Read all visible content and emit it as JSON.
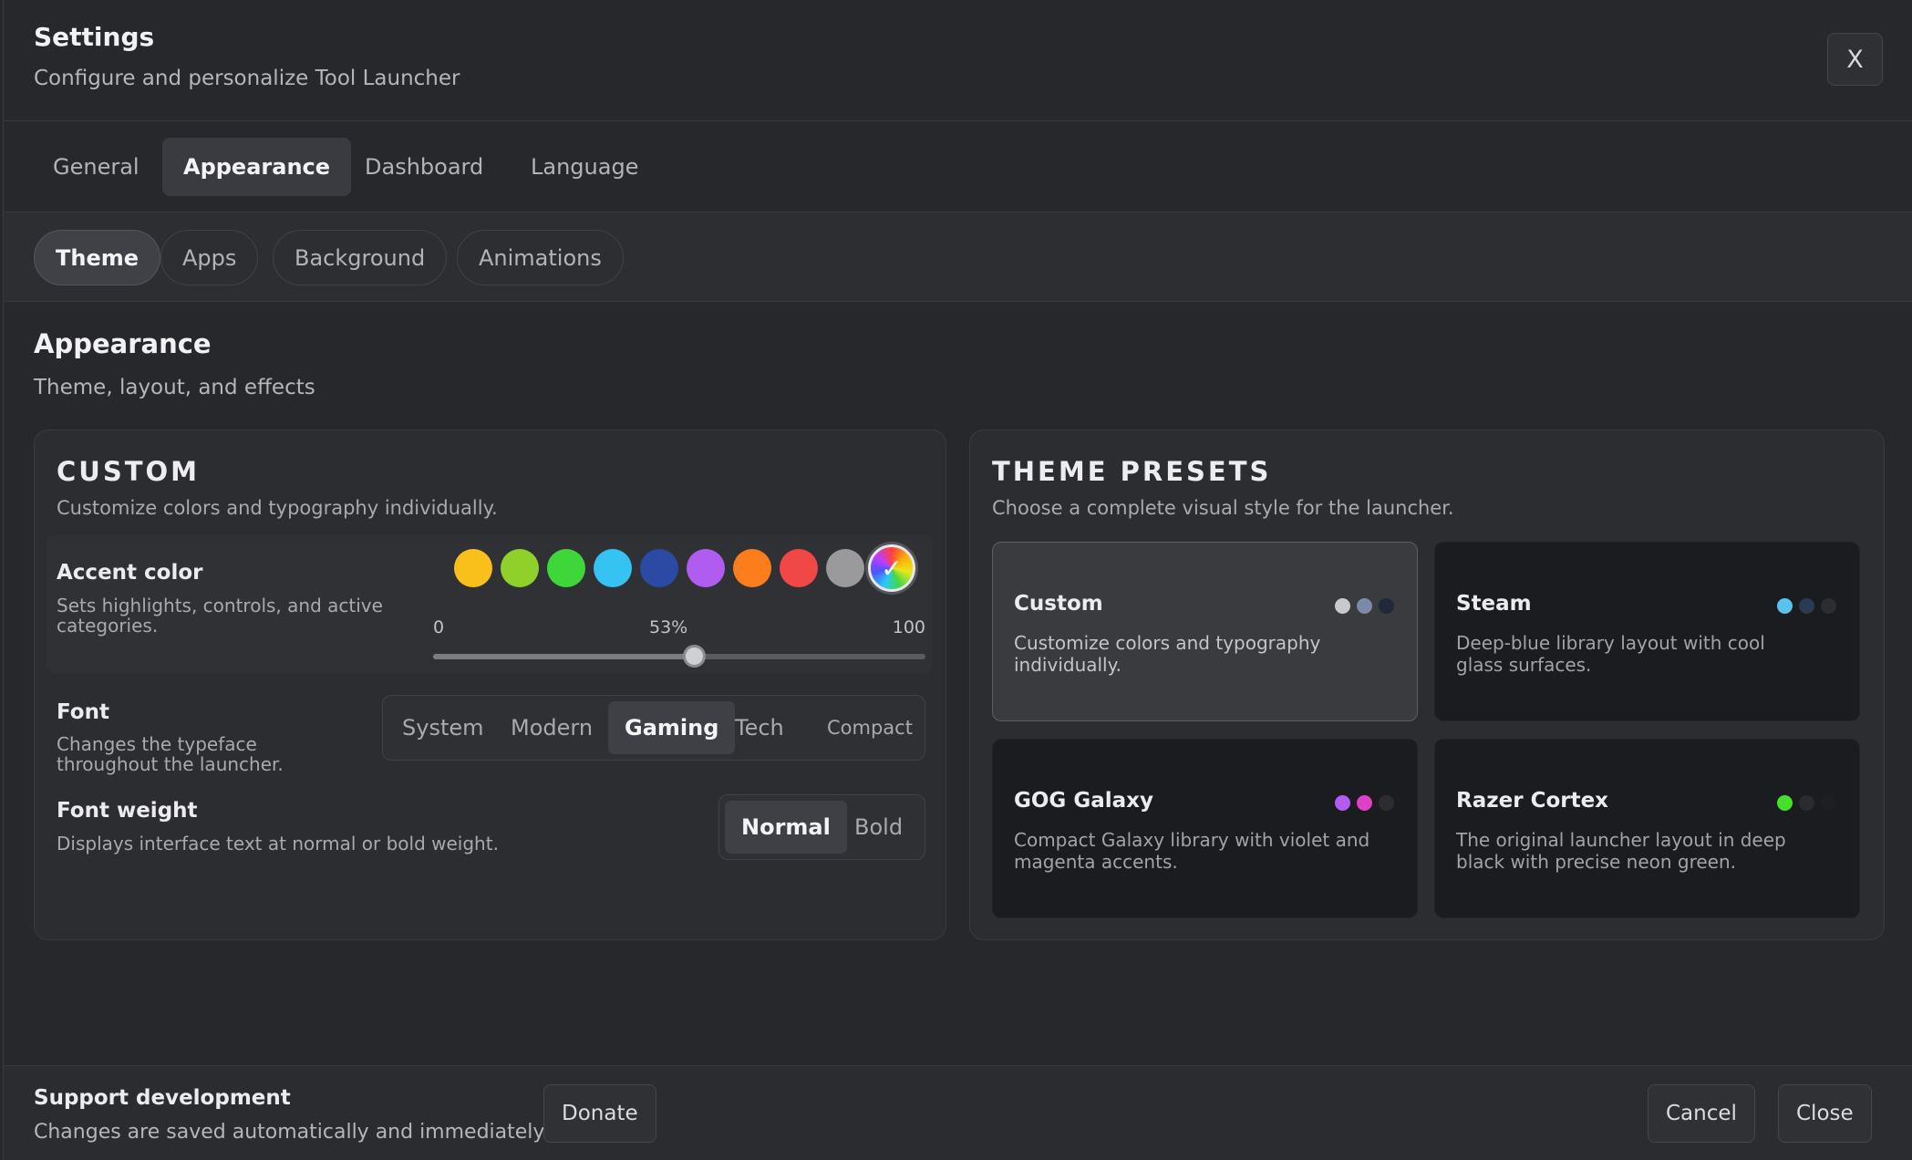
{
  "header": {
    "title": "Settings",
    "subtitle": "Configure and personalize Tool Launcher",
    "close_label": "X"
  },
  "tabs": [
    {
      "label": "General",
      "active": false
    },
    {
      "label": "Appearance",
      "active": true
    },
    {
      "label": "Dashboard",
      "active": false
    },
    {
      "label": "Language",
      "active": false
    }
  ],
  "subtabs": [
    {
      "label": "Theme",
      "active": true
    },
    {
      "label": "Apps",
      "active": false
    },
    {
      "label": "Background",
      "active": false
    },
    {
      "label": "Animations",
      "active": false
    }
  ],
  "section": {
    "title": "Appearance",
    "subtitle": "Theme, layout, and effects"
  },
  "custom": {
    "title": "CUSTOM",
    "subtitle": "Customize colors and typography individually.",
    "accent": {
      "label": "Accent color",
      "desc_line1": "Sets highlights, controls, and active",
      "desc_line2": "categories.",
      "swatches": [
        "#f9c01c",
        "#8fd12a",
        "#3fd63a",
        "#35c3f3",
        "#2b4aa3",
        "#b05cf0",
        "#fb7d1c",
        "#f24747",
        "#9a9a9c",
        "rainbow"
      ],
      "selected_swatch": "rainbow",
      "check_glyph": "✓",
      "slider": {
        "min_label": "0",
        "value_label": "53%",
        "max_label": "100",
        "value": 53
      }
    },
    "font": {
      "label": "Font",
      "desc_line1": "Changes the typeface",
      "desc_line2": "throughout the launcher.",
      "options": [
        "System",
        "Modern",
        "Gaming",
        "Tech",
        "Compact"
      ],
      "selected": "Gaming"
    },
    "weight": {
      "label": "Font weight",
      "desc": "Displays interface text at normal or bold weight.",
      "options": [
        "Normal",
        "Bold"
      ],
      "selected": "Normal"
    }
  },
  "presets": {
    "title": "THEME PRESETS",
    "subtitle": "Choose a complete visual style for the launcher.",
    "items": [
      {
        "name": "Custom",
        "desc_line1": "Customize colors and typography",
        "desc_line2": "individually.",
        "active": true,
        "dots": [
          "#c9c9cc",
          "#7b8aa6",
          "#1f2937"
        ]
      },
      {
        "name": "Steam",
        "desc_line1": "Deep-blue library layout with cool",
        "desc_line2": "glass surfaces.",
        "active": false,
        "dots": [
          "#59c3f0",
          "#2a3a55",
          "#2c2d31"
        ]
      },
      {
        "name": "GOG Galaxy",
        "desc_line1": "Compact Galaxy library with violet and",
        "desc_line2": "magenta accents.",
        "active": false,
        "dots": [
          "#b45cf0",
          "#e040c8",
          "#2c2d31"
        ]
      },
      {
        "name": "Razer Cortex",
        "desc_line1": "The original launcher layout in deep",
        "desc_line2": "black with precise neon green.",
        "active": false,
        "dots": [
          "#44e02a",
          "#2a2b2f",
          "#1e1f22"
        ]
      }
    ]
  },
  "footer": {
    "title": "Support development",
    "subtitle": "Changes are saved automatically and immediately.",
    "donate_label": "Donate",
    "cancel_label": "Cancel",
    "close_label": "Close"
  }
}
